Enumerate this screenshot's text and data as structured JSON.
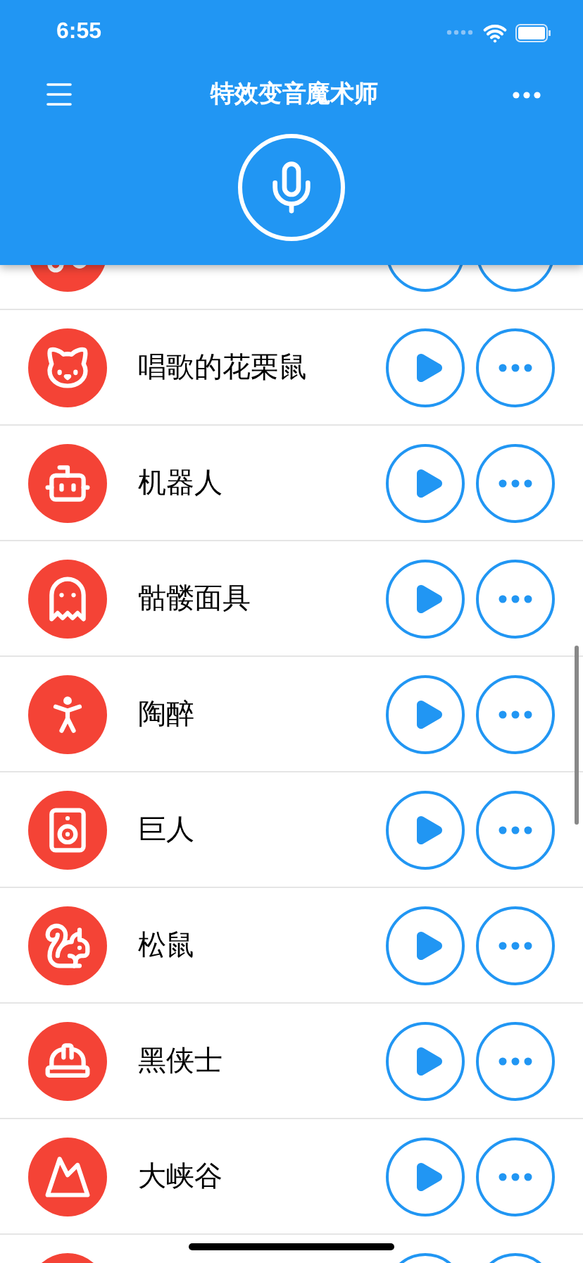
{
  "status_bar": {
    "time": "6:55"
  },
  "header": {
    "title": "特效变音魔术师"
  },
  "effects": [
    {
      "label": "唱歌的花栗鼠"
    },
    {
      "label": "机器人"
    },
    {
      "label": "骷髅面具"
    },
    {
      "label": "陶醉"
    },
    {
      "label": "巨人"
    },
    {
      "label": "松鼠"
    },
    {
      "label": "黑侠士"
    },
    {
      "label": "大峡谷"
    }
  ]
}
